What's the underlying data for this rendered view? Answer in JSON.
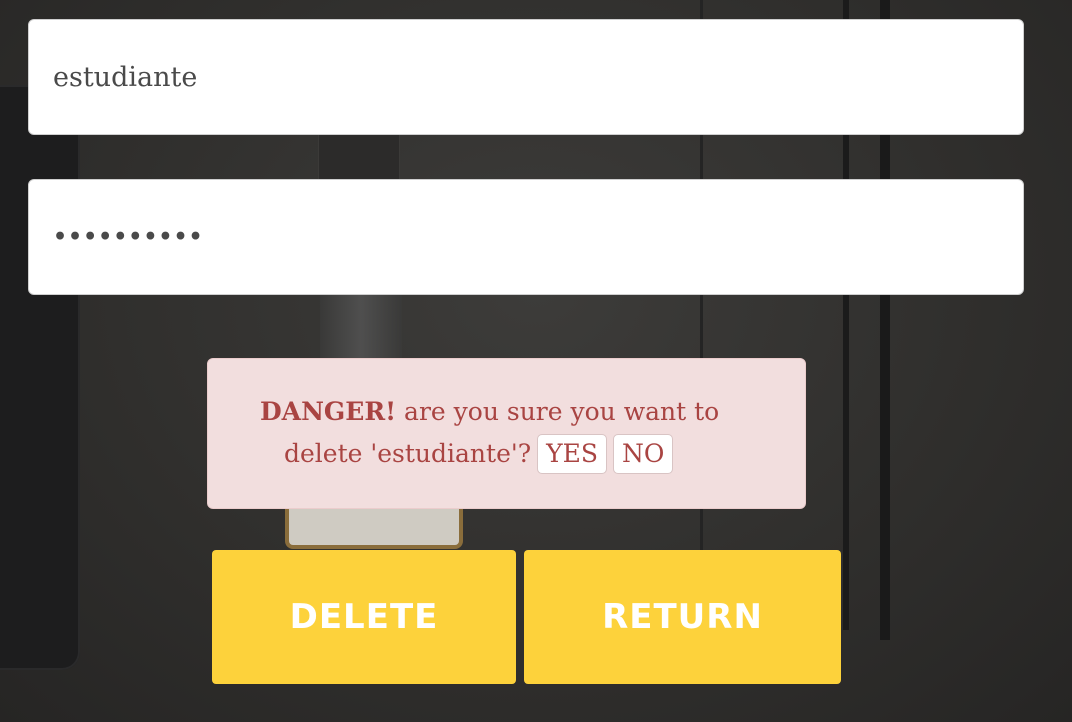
{
  "form": {
    "username_value": "estudiante",
    "password_masked": "••••••••••"
  },
  "alert": {
    "strong_text": "DANGER!",
    "message_line1": " are you sure you want to",
    "message_line2": "delete 'estudiante'?",
    "yes_label": "YES",
    "no_label": "NO"
  },
  "actions": {
    "delete_label": "DELETE",
    "return_label": "RETURN"
  },
  "colors": {
    "accent_button": "#fdd23b",
    "alert_bg": "#f2dede",
    "alert_text": "#a94442"
  }
}
